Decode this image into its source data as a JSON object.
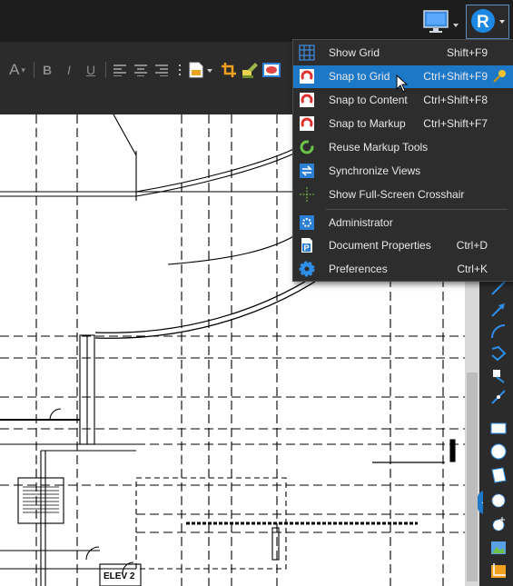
{
  "colors": {
    "accent": "#1e78c8",
    "menu_bg": "#2d2d2d",
    "toolbar_bg": "#2b2b2b",
    "canvas_bg": "#ffffff",
    "drawing_lines": "#000000"
  },
  "topbar": {
    "monitor_button_icon": "monitor-icon",
    "logo_button_icon": "revu-logo-icon"
  },
  "toolbar": {
    "font_color_glyph": "A",
    "bold_glyph": "B",
    "italic_glyph": "I",
    "underline_glyph": "U"
  },
  "menu": {
    "items": [
      {
        "label": "Show Grid",
        "shortcut": "Shift+F9",
        "icon": "grid-icon"
      },
      {
        "label": "Snap to Grid",
        "shortcut": "Ctrl+Shift+F9",
        "icon": "magnet-icon",
        "pinned": true
      },
      {
        "label": "Snap to Content",
        "shortcut": "Ctrl+Shift+F8",
        "icon": "magnet-icon"
      },
      {
        "label": "Snap to Markup",
        "shortcut": "Ctrl+Shift+F7",
        "icon": "magnet-icon"
      },
      {
        "label": "Reuse Markup Tools",
        "shortcut": "",
        "icon": "recycle-icon"
      },
      {
        "label": "Synchronize Views",
        "shortcut": "",
        "icon": "sync-icon"
      },
      {
        "label": "Show Full-Screen Crosshair",
        "shortcut": "",
        "icon": "crosshair-icon"
      },
      {
        "label": "Administrator",
        "shortcut": "",
        "icon": "admin-icon"
      },
      {
        "label": "Document Properties",
        "shortcut": "Ctrl+D",
        "icon": "document-properties-icon"
      },
      {
        "label": "Preferences",
        "shortcut": "Ctrl+K",
        "icon": "gear-icon"
      }
    ]
  },
  "drawing": {
    "room_label": "ELEV 2"
  }
}
